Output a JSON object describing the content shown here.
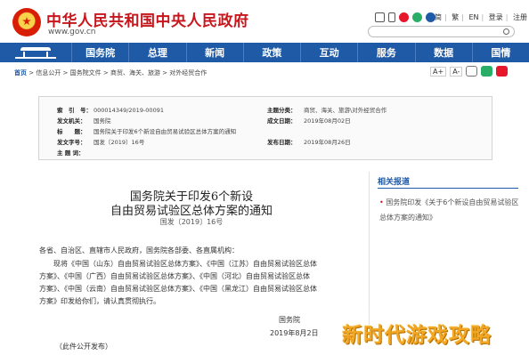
{
  "header": {
    "site_name": "中华人民共和国中央人民政府",
    "site_url": "www.gov.cn",
    "top_links": [
      "简",
      "繁",
      "EN",
      "登录",
      "注册"
    ],
    "colors": {
      "brand_red": "#c8161d",
      "nav_blue": "#1f5aa6"
    }
  },
  "nav": {
    "items": [
      "国务院",
      "总理",
      "新闻",
      "政策",
      "互动",
      "服务",
      "数据",
      "国情"
    ]
  },
  "breadcrumb": {
    "home": "首页",
    "path": " > 信息公开 > 国务院文件 > 商贸、海关、旅游 > 对外经贸合作"
  },
  "tools": {
    "font_a_plus": "A+",
    "font_a_minus": "A-"
  },
  "meta": {
    "index_label": "索　引　号：",
    "index_value": "000014349/2019-00091",
    "topic_label": "主题分类：",
    "topic_value": "商贸、海关、旅游\\对外经贸合作",
    "issuer_label": "发文机关：",
    "issuer_value": "国务院",
    "date_label": "成文日期：",
    "date_value": "2019年08月02日",
    "title_label": "标　　题：",
    "title_value": "国务院关于印发6个新设自由贸易试验区总体方案的通知",
    "number_label": "发文字号：",
    "number_value": "国发〔2019〕16号",
    "publish_label": "发布日期：",
    "publish_value": "2019年08月26日",
    "keywords_label": "主 题 词：",
    "keywords_value": ""
  },
  "document": {
    "title_line1": "国务院关于印发6个新设",
    "title_line2": "自由贸易试验区总体方案的通知",
    "doc_number": "国发〔2019〕16号",
    "recipients": "各省、自治区、直辖市人民政府，国务院各部委、各直属机构：",
    "body_lines": [
      "　　现将《中国（山东）自由贸易试验区总体方案》、《中国（江苏）自由贸易试验区总体",
      "方案》、《中国（广西）自由贸易试验区总体方案》、《中国（河北）自由贸易试验区总体",
      "方案》、《中国（云南）自由贸易试验区总体方案》、《中国（黑龙江）自由贸易试验区总体",
      "方案》印发给你们，请认真贯彻执行。"
    ],
    "signer": "国务院",
    "sign_date": "2019年8月2日",
    "footnote": "（此件公开发布）"
  },
  "sidebar": {
    "title": "相关报道",
    "link": "国务院印发《关于6个新设自由贸易试验区总体方案的通知》"
  },
  "watermark": "新时代游戏攻略"
}
